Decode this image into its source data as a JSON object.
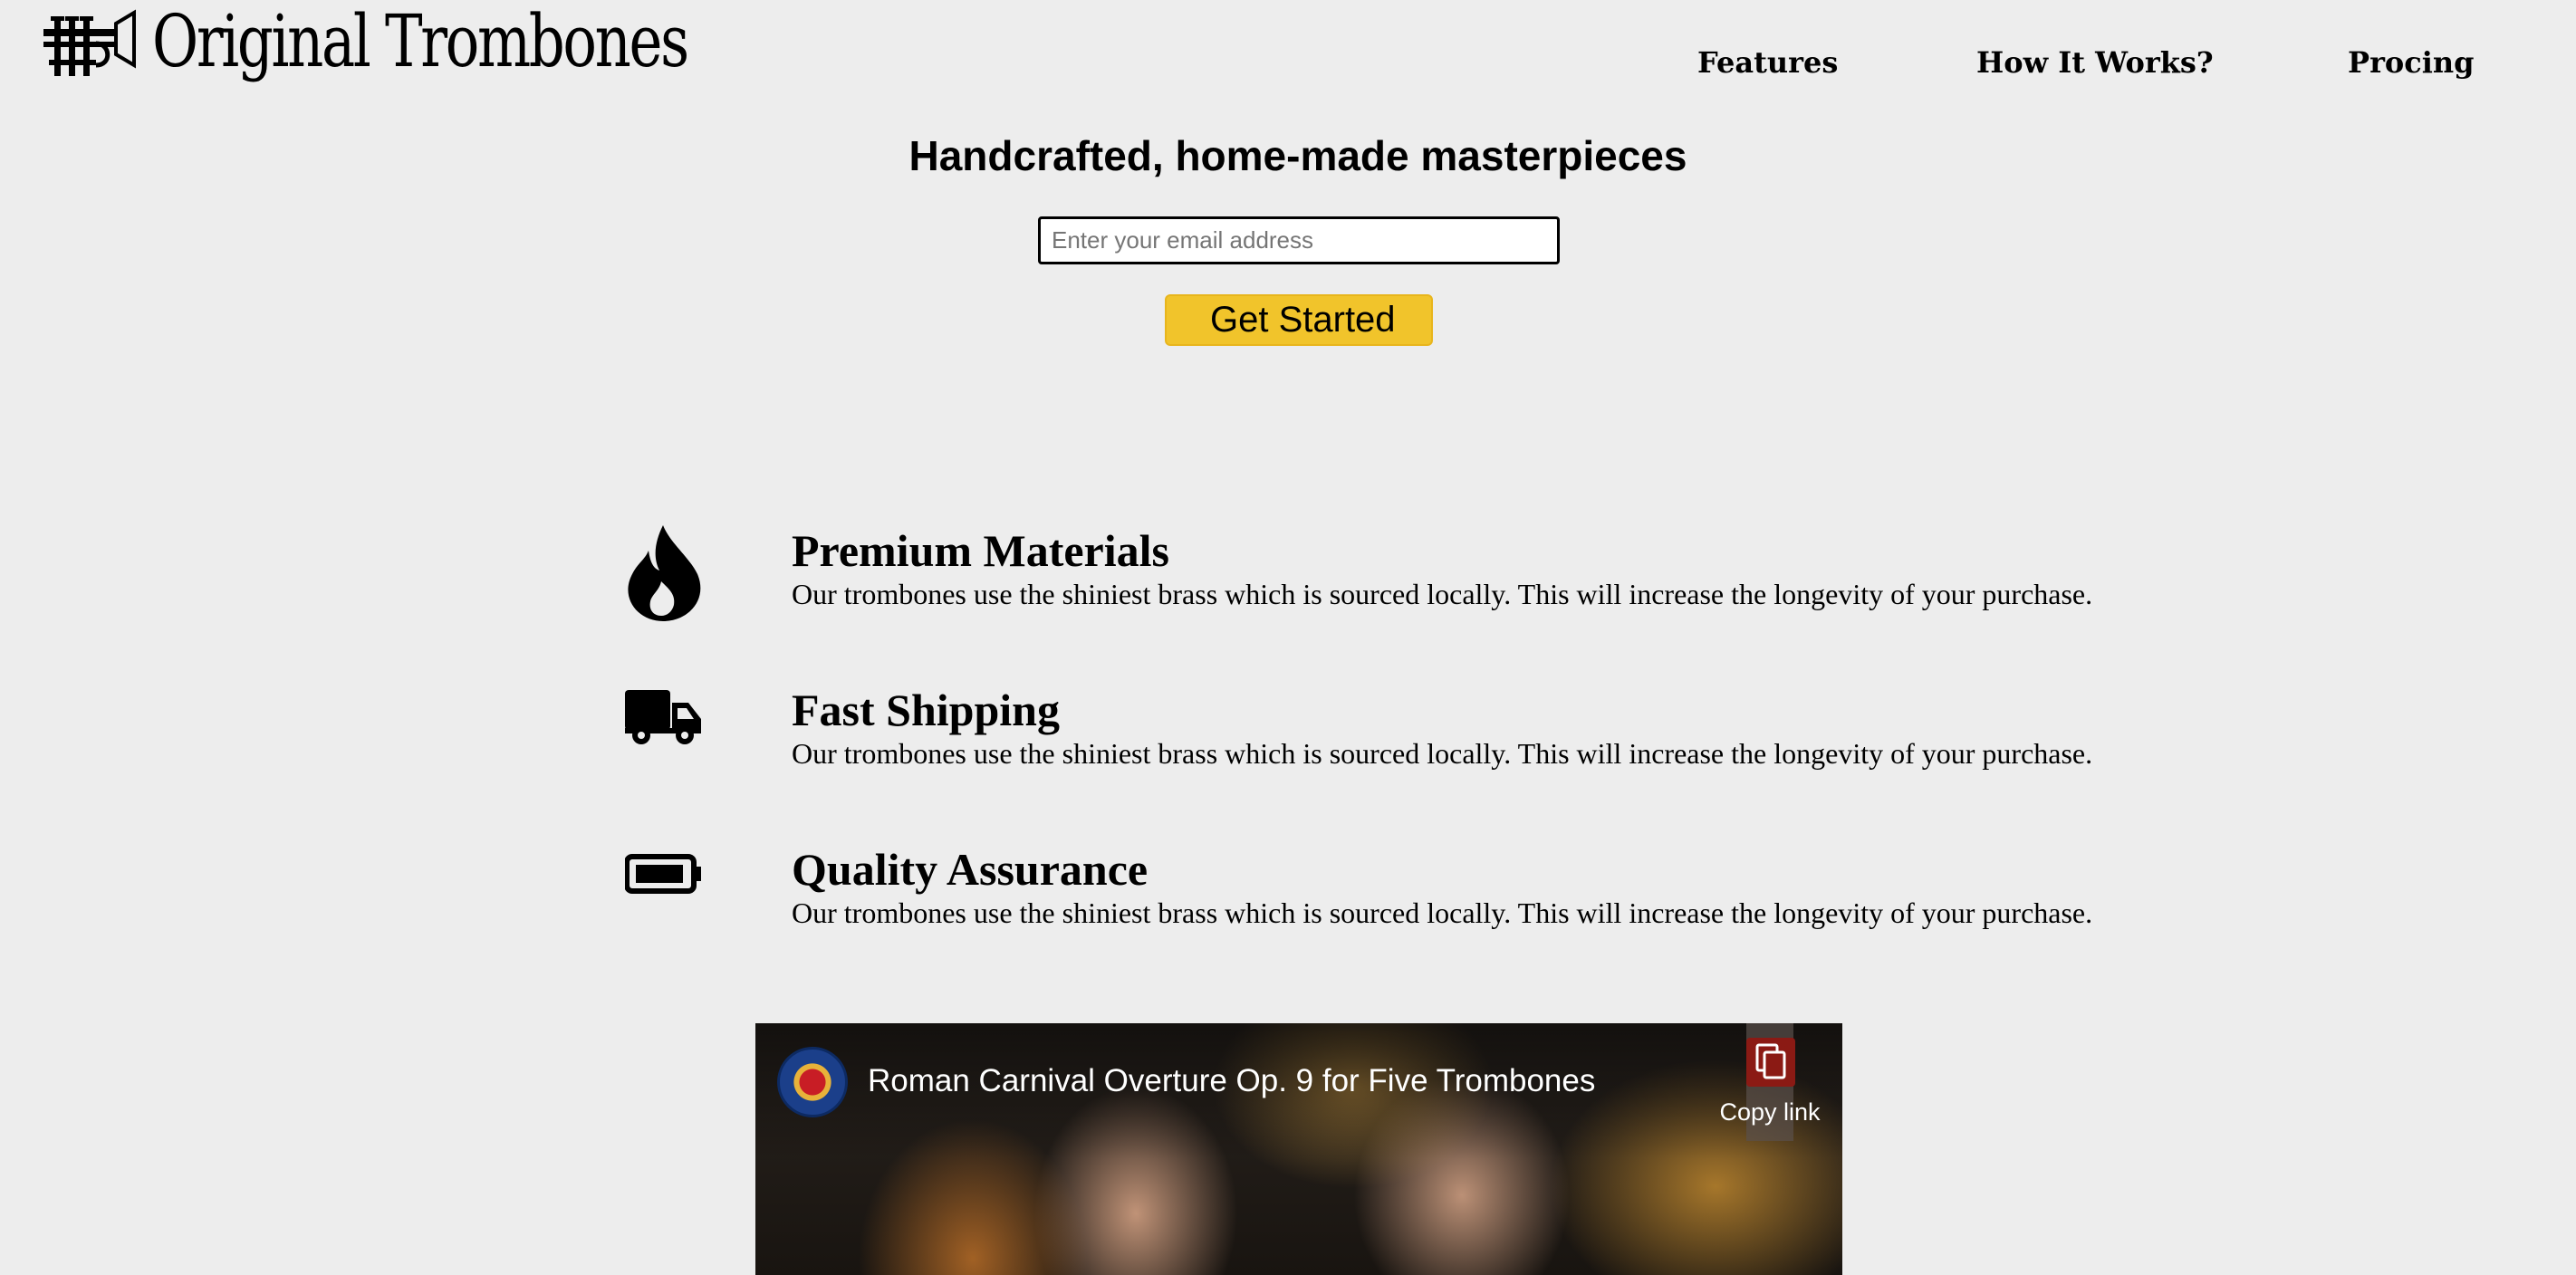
{
  "brand": {
    "name": "Original Trombones",
    "logo_icon": "trumpet-icon"
  },
  "nav": {
    "items": [
      {
        "label": "Features"
      },
      {
        "label": "How It Works?"
      },
      {
        "label": "Procing"
      }
    ]
  },
  "hero": {
    "heading": "Handcrafted, home-made masterpieces",
    "email_placeholder": "Enter your email address",
    "email_value": "",
    "cta_label": "Get Started",
    "cta_color": "#f1c42b"
  },
  "features": [
    {
      "icon": "fire-icon",
      "title": "Premium Materials",
      "description": "Our trombones use the shiniest brass which is sourced locally. This will increase the longevity of your purchase."
    },
    {
      "icon": "truck-icon",
      "title": "Fast Shipping",
      "description": "Our trombones use the shiniest brass which is sourced locally. This will increase the longevity of your purchase."
    },
    {
      "icon": "battery-icon",
      "title": "Quality Assurance",
      "description": "Our trombones use the shiniest brass which is sourced locally. This will increase the longevity of your purchase."
    }
  ],
  "video": {
    "title": "Roman Carnival Overture Op. 9 for Five Trombones",
    "copy_link_label": "Copy link",
    "channel_icon": "channel-avatar"
  }
}
